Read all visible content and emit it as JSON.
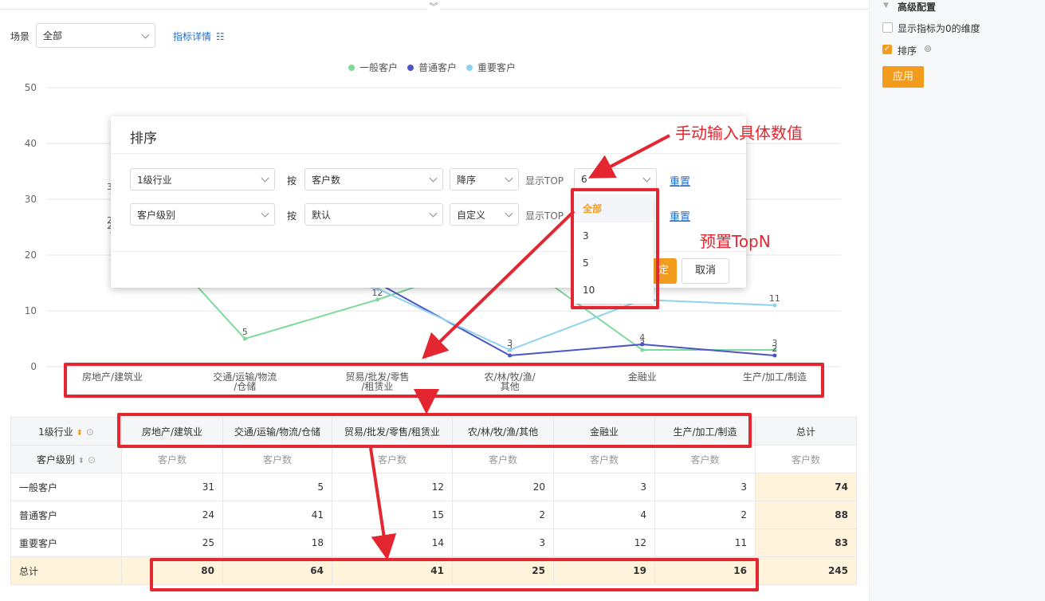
{
  "filter": {
    "label": "场景",
    "value": "全部",
    "detail_link": "指标详情"
  },
  "chart_data": {
    "type": "line",
    "categories": [
      "房地产/建筑业",
      "交通/运输/物流/仓储",
      "贸易/批发/零售/租赁业",
      "农/林/牧/渔/其他",
      "金融业",
      "生产/加工/制造"
    ],
    "category_labels": [
      [
        "房地产/建筑业"
      ],
      [
        "交通/运输/物流",
        "/仓储"
      ],
      [
        "贸易/批发/零售",
        "/租赁业"
      ],
      [
        "农/林/牧/渔/",
        "其他"
      ],
      [
        "金融业"
      ],
      [
        "生产/加工/制造"
      ]
    ],
    "series": [
      {
        "name": "一般客户",
        "color": "#7fd99a",
        "values": [
          31,
          5,
          12,
          20,
          3,
          3
        ]
      },
      {
        "name": "普通客户",
        "color": "#4b55c4",
        "values": [
          24,
          41,
          15,
          2,
          4,
          2
        ]
      },
      {
        "name": "重要客户",
        "color": "#8dd3ee",
        "values": [
          25,
          18,
          14,
          3,
          12,
          11
        ]
      }
    ],
    "yticks": [
      "0",
      "10",
      "20",
      "30",
      "40",
      "50"
    ],
    "ylim": [
      0,
      50
    ],
    "grid": true,
    "legend": "top-center"
  },
  "modal": {
    "title": "排序",
    "by_label": "按",
    "topn_label": "显示TOP",
    "reset_label": "重置",
    "cancel_label": "取消",
    "confirm_label": "定",
    "rows": [
      {
        "dimension": "1级行业",
        "metric": "客户数",
        "order": "降序",
        "topn": "6"
      },
      {
        "dimension": "客户级别",
        "metric": "默认",
        "order": "自定义",
        "topn": ""
      }
    ]
  },
  "topn_dropdown": {
    "options": [
      "全部",
      "3",
      "5",
      "10"
    ],
    "selected": "全部"
  },
  "annotations": {
    "manual_input": "手动输入具体数值",
    "preset_topn": "预置TopN"
  },
  "table": {
    "dim1_label": "1级行业",
    "dim2_label": "客户级别",
    "columns": [
      "房地产/建筑业",
      "交通/运输/物流/仓储",
      "贸易/批发/零售/租赁业",
      "农/林/牧/渔/其他",
      "金融业",
      "生产/加工/制造",
      "总计"
    ],
    "metric_label": "客户数",
    "rows": [
      {
        "label": "一般客户",
        "values": [
          "31",
          "5",
          "12",
          "20",
          "3",
          "3",
          "74"
        ]
      },
      {
        "label": "普通客户",
        "values": [
          "24",
          "41",
          "15",
          "2",
          "4",
          "2",
          "88"
        ]
      },
      {
        "label": "重要客户",
        "values": [
          "25",
          "18",
          "14",
          "3",
          "12",
          "11",
          "83"
        ]
      },
      {
        "label": "总计",
        "values": [
          "80",
          "64",
          "41",
          "25",
          "19",
          "16",
          "245"
        ]
      }
    ]
  },
  "right_panel": {
    "title": "高级配置",
    "options": [
      {
        "label": "显示指标为0的维度",
        "checked": false
      },
      {
        "label": "排序",
        "checked": true
      }
    ],
    "apply_label": "应用",
    "accent": "#f39b1c"
  }
}
